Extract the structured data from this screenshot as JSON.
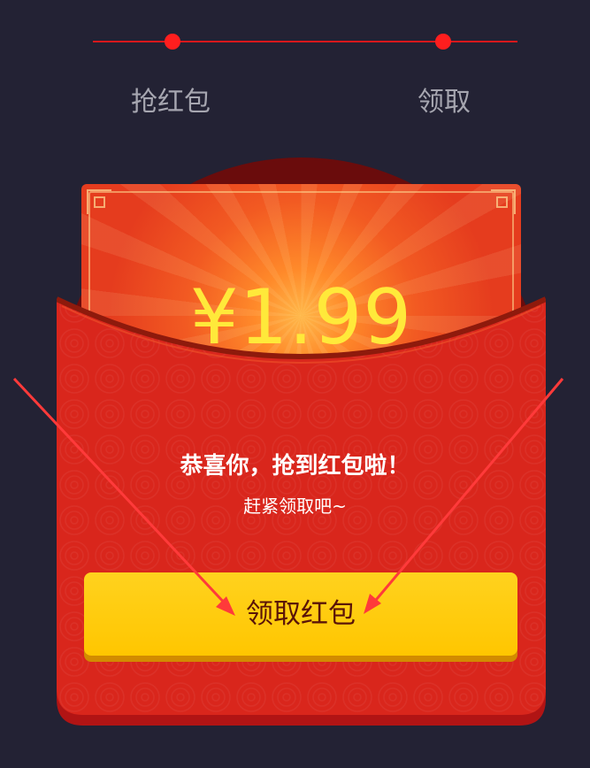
{
  "steps": {
    "step1_label": "抢红包",
    "step2_label": "领取"
  },
  "envelope": {
    "amount": "¥1.99",
    "message_title": "恭喜你，抢到红包啦！",
    "message_subtitle": "赶紧领取吧~",
    "claim_button_label": "领取红包"
  },
  "colors": {
    "background": "#232234",
    "accent_red": "#d8181c",
    "amount_yellow": "#ffe93a",
    "button_yellow": "#ffc600"
  }
}
